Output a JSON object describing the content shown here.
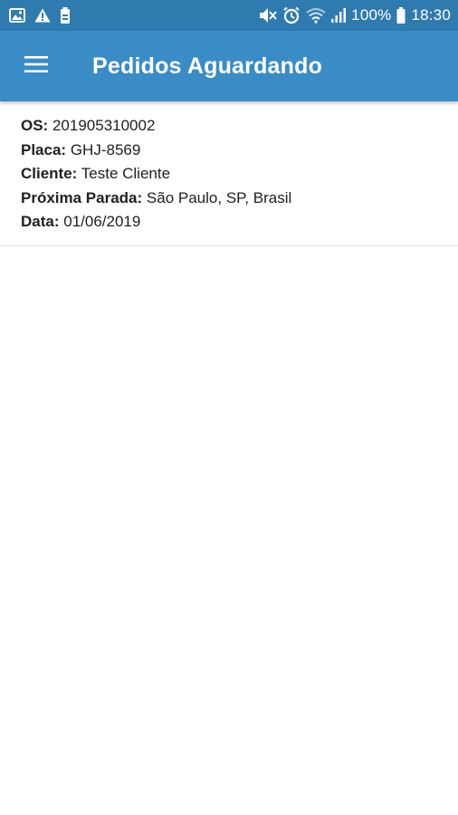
{
  "status_bar": {
    "battery_percent": "100%",
    "time": "18:30",
    "left_icons": [
      "image-icon",
      "warning-icon",
      "battery-saver-icon"
    ],
    "right_icons": [
      "mute-icon",
      "alarm-icon",
      "wifi-icon",
      "signal-icon",
      "battery-icon"
    ]
  },
  "app_bar": {
    "title": "Pedidos Aguardando",
    "menu_icon": "hamburger-menu-icon",
    "color": "#3a8cc7"
  },
  "orders": [
    {
      "os_label": "OS:",
      "os_value": "201905310002",
      "placa_label": "Placa:",
      "placa_value": "GHJ-8569",
      "cliente_label": "Cliente:",
      "cliente_value": "Teste Cliente",
      "parada_label": "Próxima Parada:",
      "parada_value": "São Paulo, SP, Brasil",
      "data_label": "Data:",
      "data_value": "01/06/2019"
    }
  ],
  "colors": {
    "status_bar": "#2f7bb0",
    "app_bar": "#3a8cc7",
    "text": "#202020",
    "divider": "#e2e2e2"
  }
}
